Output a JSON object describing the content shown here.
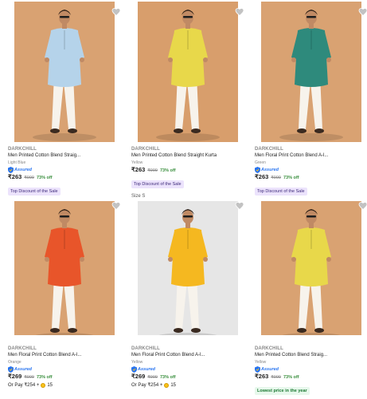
{
  "products": [
    {
      "brand": "DARKCHILL",
      "title": "Men Printed Cotton Blend Straig...",
      "color": "Light Blue",
      "assured": "Assured",
      "price": "₹263",
      "mrp": "₹999",
      "discount": "73% off",
      "badge": "Top Discount of the Sale",
      "badge_style": "purple",
      "kurta_color": "#b5d3ea",
      "bg_color": "#d9a272"
    },
    {
      "brand": "DARKCHILL",
      "title": "Men Printed Cotton Blend Straight Kurta",
      "color": "Yellow",
      "assured": "",
      "price": "₹263",
      "mrp": "₹999",
      "discount": "73% off",
      "badge": "Top Discount of the Sale",
      "badge_style": "purple",
      "kurta_color": "#e8d84a",
      "bg_color": "#d89e6c"
    },
    {
      "brand": "DARKCHILL",
      "title": "Men Floral Print Cotton Blend A-l...",
      "color": "Green",
      "assured": "Assured",
      "price": "₹263",
      "mrp": "₹999",
      "discount": "73% off",
      "badge": "Top Discount of the Sale",
      "badge_style": "purple",
      "kurta_color": "#2e8a7c",
      "bg_color": "#d9a272"
    },
    {
      "brand": "DARKCHILL",
      "title": "Men Floral Print Cotton Blend A-l...",
      "color": "Orange",
      "assured": "Assured",
      "price": "₹269",
      "mrp": "₹999",
      "discount": "73% off",
      "pay_prefix": "Or Pay ₹254 +",
      "pay_coins": "15",
      "kurta_color": "#e8552a",
      "bg_color": "#d9a272"
    },
    {
      "size_label": "Size S",
      "brand": "DARKCHILL",
      "title": "Men Floral Print Cotton Blend A-l...",
      "color": "Yellow",
      "assured": "Assured",
      "price": "₹269",
      "mrp": "₹999",
      "discount": "73% off",
      "pay_prefix": "Or Pay ₹254 +",
      "pay_coins": "15",
      "kurta_color": "#f5b820",
      "bg_color": "#e6e6e6"
    },
    {
      "brand": "DARKCHILL",
      "title": "Men Printed Cotton Blend Straig...",
      "color": "Yellow",
      "assured": "Assured",
      "price": "₹263",
      "mrp": "₹999",
      "discount": "73% off",
      "badge": "Lowest price in the year",
      "badge_style": "green",
      "kurta_color": "#e8d84a",
      "bg_color": "#d9a272"
    }
  ]
}
